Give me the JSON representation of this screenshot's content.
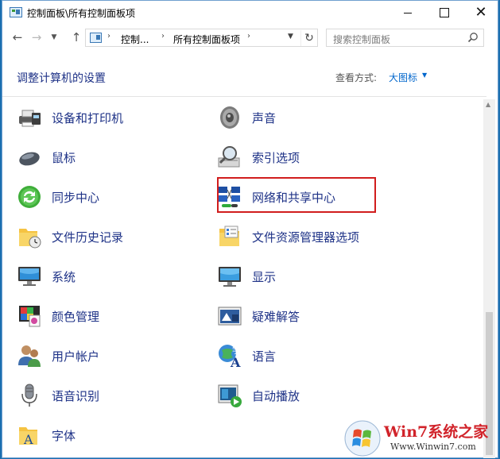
{
  "window": {
    "title": "控制面板\\所有控制面板项",
    "buttons": {
      "minimize": "minimize",
      "maximize": "maximize",
      "close": "close"
    }
  },
  "nav": {
    "breadcrumbs": [
      "控制...",
      "所有控制面板项"
    ],
    "search_placeholder": "搜索控制面板"
  },
  "header": {
    "title": "调整计算机的设置",
    "view_label": "查看方式:",
    "view_value": "大图标"
  },
  "items_left": [
    {
      "label": "设备和打印机",
      "icon": "printer-icon"
    },
    {
      "label": "鼠标",
      "icon": "mouse-icon"
    },
    {
      "label": "同步中心",
      "icon": "sync-icon"
    },
    {
      "label": "文件历史记录",
      "icon": "file-history-icon"
    },
    {
      "label": "系统",
      "icon": "system-icon"
    },
    {
      "label": "颜色管理",
      "icon": "color-management-icon"
    },
    {
      "label": "用户帐户",
      "icon": "user-accounts-icon"
    },
    {
      "label": "语音识别",
      "icon": "microphone-icon"
    },
    {
      "label": "字体",
      "icon": "fonts-icon"
    }
  ],
  "items_right": [
    {
      "label": "声音",
      "icon": "speaker-icon"
    },
    {
      "label": "索引选项",
      "icon": "indexing-icon"
    },
    {
      "label": "网络和共享中心",
      "icon": "network-icon",
      "highlighted": true
    },
    {
      "label": "文件资源管理器选项",
      "icon": "folder-options-icon"
    },
    {
      "label": "显示",
      "icon": "display-icon"
    },
    {
      "label": "疑难解答",
      "icon": "troubleshoot-icon"
    },
    {
      "label": "语言",
      "icon": "language-icon"
    },
    {
      "label": "自动播放",
      "icon": "autoplay-icon"
    }
  ],
  "watermark": {
    "main": "Win7系统之家",
    "sub": "Www.Winwin7.com"
  },
  "colors": {
    "link": "#1e3287",
    "accent": "#0066cc",
    "highlight_border": "#d11d1d"
  }
}
